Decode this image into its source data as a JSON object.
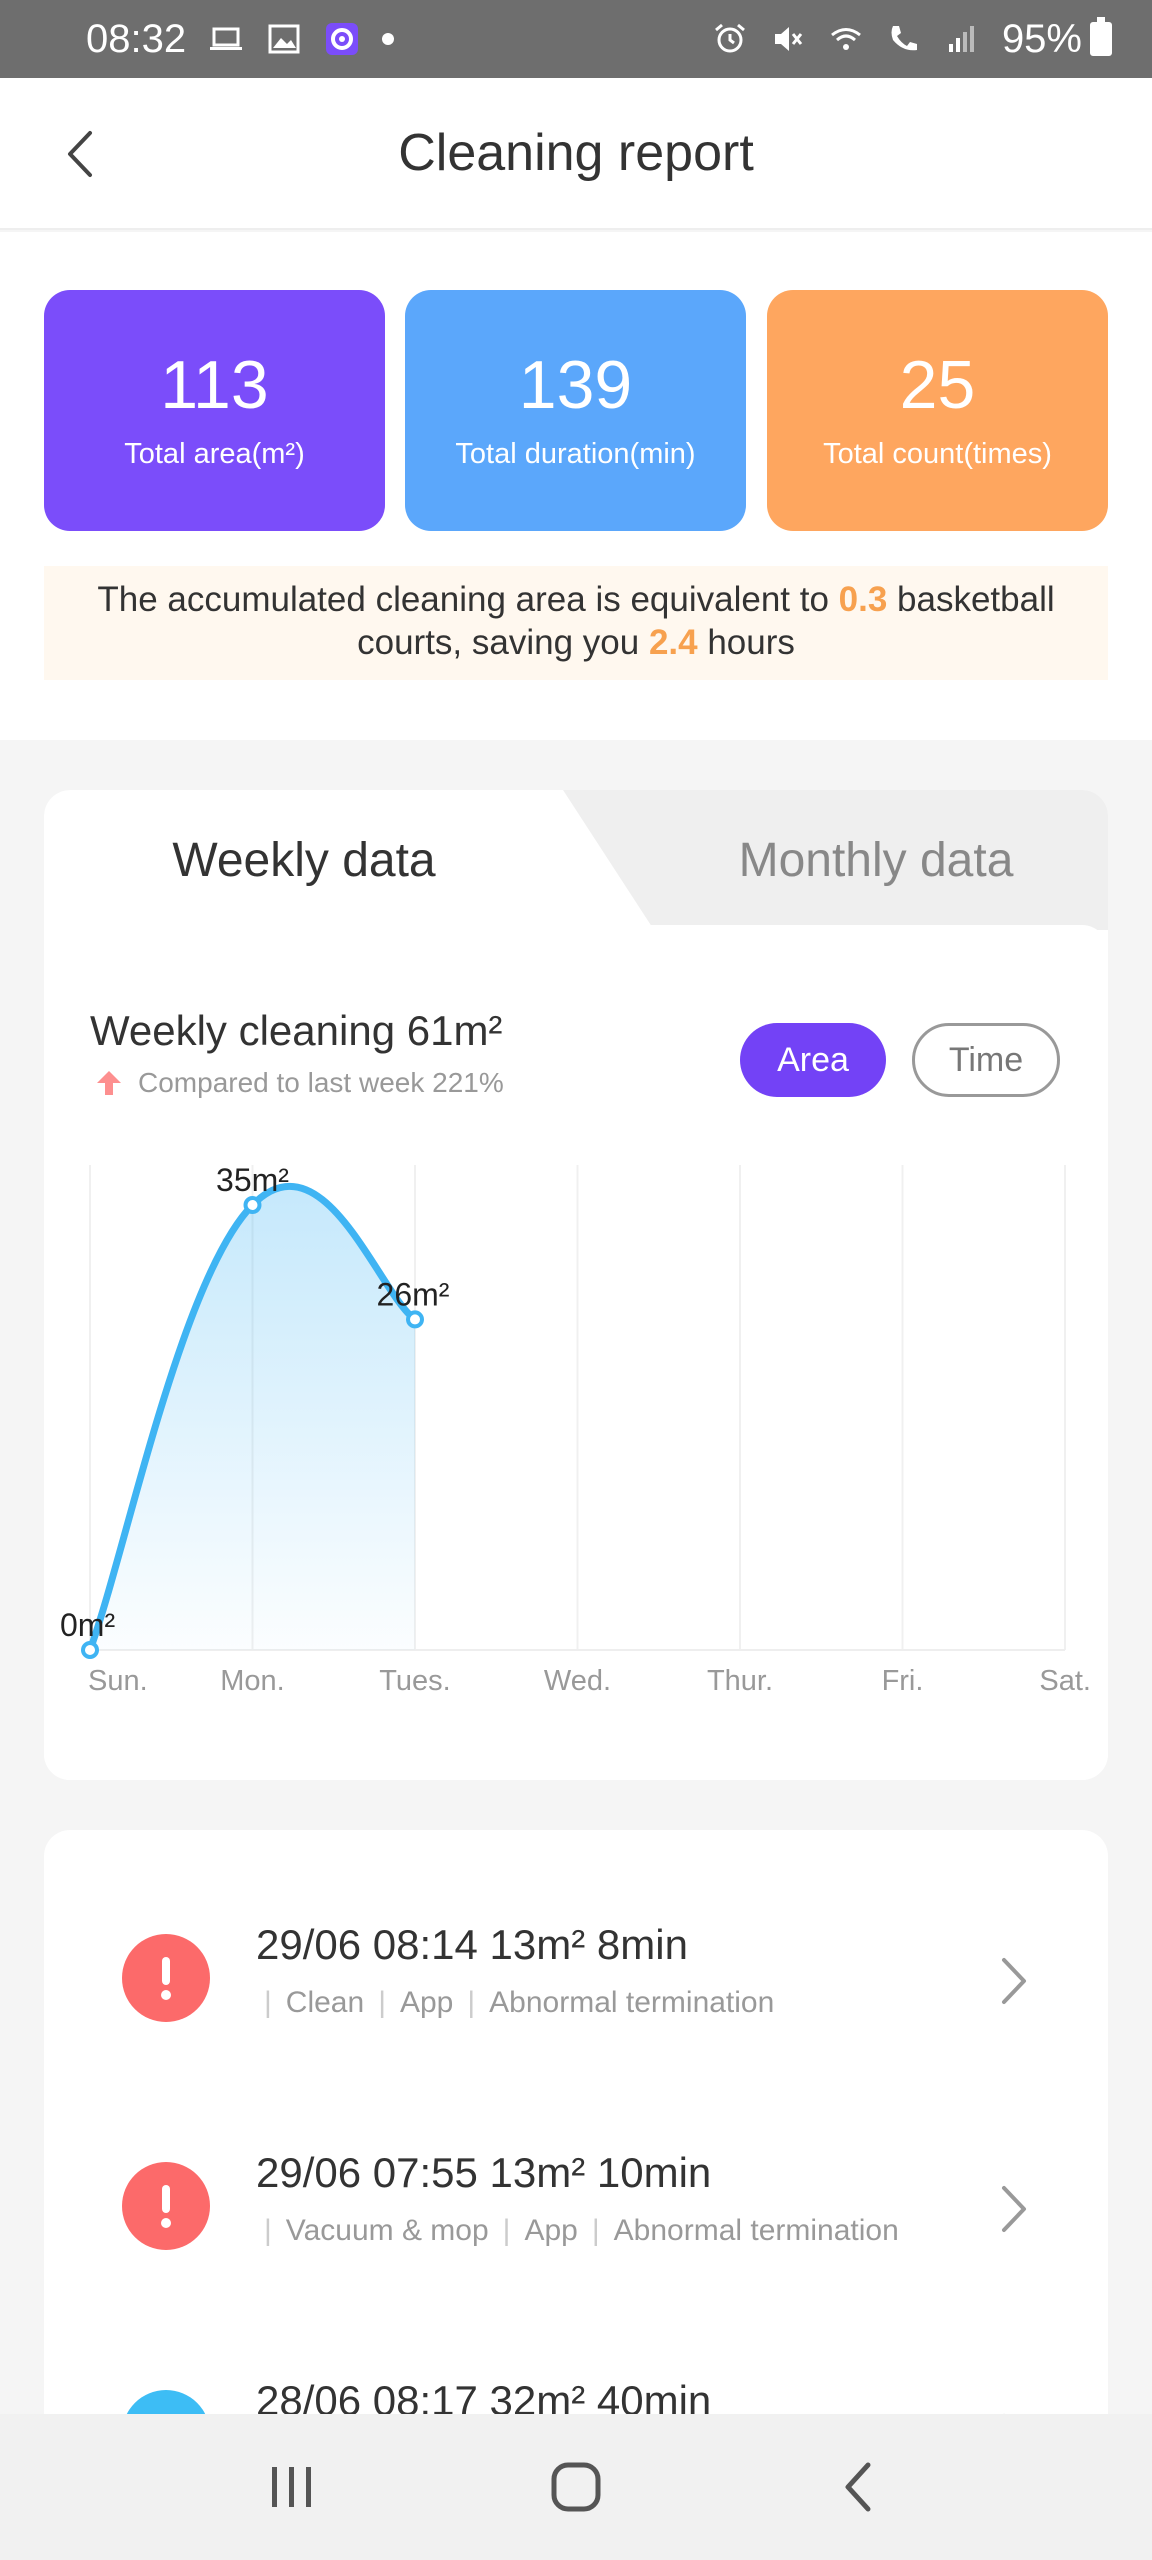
{
  "status_bar": {
    "time": "08:32",
    "battery": "95%",
    "icons": [
      "laptop-icon",
      "gallery-icon",
      "app-icon",
      "dot-icon",
      "alarm-icon",
      "mute-icon",
      "wifi-icon",
      "call-icon",
      "signal-icon",
      "battery-icon"
    ]
  },
  "header": {
    "title": "Cleaning report",
    "back_icon": "chevron-left-icon"
  },
  "stats": [
    {
      "value": "113",
      "label": "Total area(m²)",
      "color": "#7b4dfa"
    },
    {
      "value": "139",
      "label": "Total duration(min)",
      "color": "#5ba7fb"
    },
    {
      "value": "25",
      "label": "Total count(times)",
      "color": "#fea65f"
    }
  ],
  "notice": {
    "part1": "The accumulated cleaning area is equivalent to ",
    "courts": "0.3",
    "part2": " basketball courts, saving you ",
    "hours": "2.4",
    "part3": " hours",
    "highlight_color": "#f7a14f"
  },
  "tabs": {
    "active": "Weekly data",
    "inactive": "Monthly data"
  },
  "weekly": {
    "title": "Weekly cleaning 61m²",
    "compare": "Compared to last week 221%",
    "toggle_area": "Area",
    "toggle_time": "Time",
    "accent": "#7342f6"
  },
  "chart_data": {
    "type": "area",
    "categories": [
      "Sun.",
      "Mon.",
      "Tues.",
      "Wed.",
      "Thur.",
      "Fri.",
      "Sat."
    ],
    "values": [
      0,
      35,
      26,
      null,
      null,
      null,
      null
    ],
    "data_labels": [
      "0m²",
      "35m²",
      "26m²"
    ],
    "ylim": [
      0,
      35
    ],
    "line_color": "#3fb4f3",
    "grid": "vertical"
  },
  "records": [
    {
      "title": "29/06 08:14  13m² 8min",
      "tags": [
        "Clean",
        "App",
        "Abnormal termination"
      ],
      "status": "error"
    },
    {
      "title": "29/06 07:55  13m² 10min",
      "tags": [
        "Vacuum & mop",
        "App",
        "Abnormal termination"
      ],
      "status": "error"
    },
    {
      "title": "28/06 08:17  32m² 40min",
      "tags": [],
      "status": "ok"
    }
  ],
  "nav": [
    "recents-icon",
    "home-icon",
    "back-icon"
  ]
}
